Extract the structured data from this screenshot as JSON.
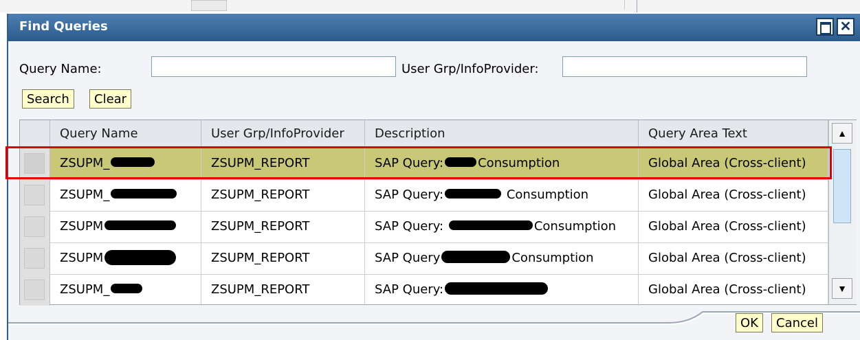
{
  "dialog": {
    "title": "Find Queries"
  },
  "form": {
    "query_name_label": "Query Name:",
    "query_name_value": "",
    "user_grp_label": "User Grp/InfoProvider:",
    "user_grp_value": "",
    "search_label": "Search",
    "clear_label": "Clear"
  },
  "table": {
    "columns": [
      "Query Name",
      "User Grp/InfoProvider",
      "Description",
      "Query Area Text"
    ],
    "rows": [
      {
        "name": "ZSUPM_",
        "group": "ZSUPM_REPORT",
        "desc_prefix": "SAP Query:",
        "desc_suffix": "Consumption",
        "area": "Global Area (Cross-client)",
        "selected": true
      },
      {
        "name": "ZSUPM_",
        "group": "ZSUPM_REPORT",
        "desc_prefix": "SAP Query:",
        "desc_suffix": "Consumption",
        "area": "Global Area (Cross-client)",
        "selected": false
      },
      {
        "name": "ZSUPM",
        "group": "ZSUPM_REPORT",
        "desc_prefix": "SAP Query:",
        "desc_suffix": "Consumption",
        "area": "Global Area (Cross-client)",
        "selected": false
      },
      {
        "name": "ZSUPM",
        "group": "ZSUPM_REPORT",
        "desc_prefix": "SAP Query",
        "desc_suffix": "Consumption",
        "area": "Global Area (Cross-client)",
        "selected": false
      },
      {
        "name": "ZSUPM_",
        "group": "ZSUPM_REPORT",
        "desc_prefix": "SAP Query:",
        "desc_suffix": "",
        "area": "Global Area (Cross-client)",
        "selected": false
      }
    ]
  },
  "footer": {
    "ok_label": "OK",
    "cancel_label": "Cancel"
  },
  "colors": {
    "title_bar": "#2c5b8d",
    "selected_row": "#c8c876",
    "highlight_border": "#e00000",
    "button_bg": "#ffffcc"
  },
  "icons": {
    "maximize": "maximize-icon",
    "close": "close-icon",
    "scroll_up": "scroll-up-icon",
    "scroll_down": "scroll-down-icon"
  }
}
